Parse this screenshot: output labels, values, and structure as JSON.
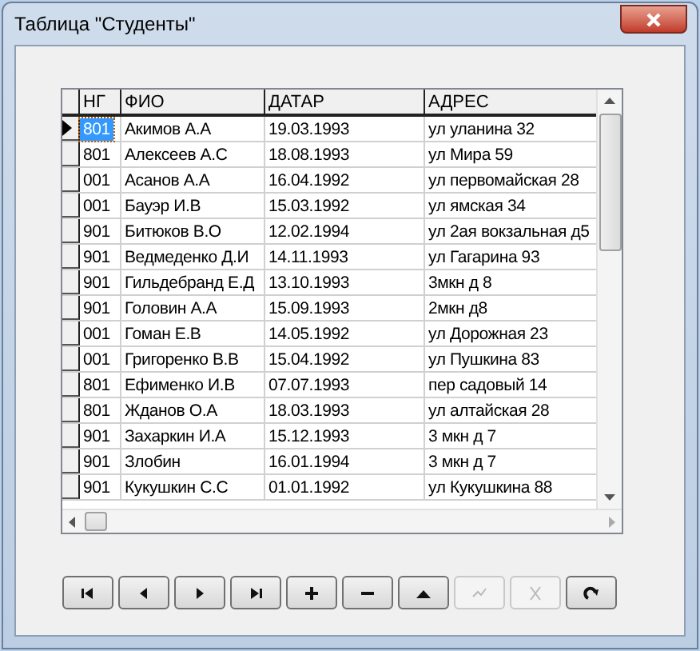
{
  "window": {
    "title": "Таблица \"Студенты\""
  },
  "table": {
    "columns": [
      "НГ",
      "ФИО",
      "ДАТАР",
      "АДРЕС"
    ],
    "rows": [
      {
        "cells": [
          "801",
          "Акимов А.А",
          "19.03.1993",
          "ул уланина 32"
        ],
        "selected": true
      },
      {
        "cells": [
          "801",
          "Алексеев А.С",
          "18.08.1993",
          "ул Мира 59"
        ],
        "selected": false
      },
      {
        "cells": [
          "001",
          "Асанов А.А",
          "16.04.1992",
          "ул первомайская 28"
        ],
        "selected": false
      },
      {
        "cells": [
          "001",
          "Бауэр И.В",
          "15.03.1992",
          "ул ямская 34"
        ],
        "selected": false
      },
      {
        "cells": [
          "901",
          "Битюков В.О",
          "12.02.1994",
          "ул 2ая вокзальная д5"
        ],
        "selected": false
      },
      {
        "cells": [
          "901",
          "Ведмеденко Д.И",
          "14.11.1993",
          "ул Гагарина 93"
        ],
        "selected": false
      },
      {
        "cells": [
          "901",
          "Гильдебранд Е.Д",
          "13.10.1993",
          "3мкн д 8"
        ],
        "selected": false
      },
      {
        "cells": [
          "901",
          "Головин А.А",
          "15.09.1993",
          "2мкн д8"
        ],
        "selected": false
      },
      {
        "cells": [
          "001",
          "Гоман Е.В",
          "14.05.1992",
          "ул Дорожная 23"
        ],
        "selected": false
      },
      {
        "cells": [
          "001",
          "Григоренко В.В",
          "15.04.1992",
          "ул Пушкина 83"
        ],
        "selected": false
      },
      {
        "cells": [
          "801",
          "Ефименко И.В",
          "07.07.1993",
          "пер садовый 14"
        ],
        "selected": false
      },
      {
        "cells": [
          "801",
          "Жданов О.А",
          "18.03.1993",
          "ул алтайская 28"
        ],
        "selected": false
      },
      {
        "cells": [
          "901",
          "Захаркин И.А",
          "15.12.1993",
          "3 мкн д 7"
        ],
        "selected": false
      },
      {
        "cells": [
          "901",
          "Злобин",
          "16.01.1994",
          "3 мкн д  7"
        ],
        "selected": false
      },
      {
        "cells": [
          "901",
          "Кукушкин С.С",
          "01.01.1992",
          "ул Кукушкина 88"
        ],
        "selected": false
      }
    ]
  },
  "navigator": [
    {
      "kind": "first",
      "disabled": false
    },
    {
      "kind": "prior",
      "disabled": false
    },
    {
      "kind": "next",
      "disabled": false
    },
    {
      "kind": "last",
      "disabled": false
    },
    {
      "kind": "insert",
      "disabled": false
    },
    {
      "kind": "delete",
      "disabled": false
    },
    {
      "kind": "edit",
      "disabled": false
    },
    {
      "kind": "post",
      "disabled": true
    },
    {
      "kind": "cancel",
      "disabled": true
    },
    {
      "kind": "refresh",
      "disabled": false
    }
  ]
}
